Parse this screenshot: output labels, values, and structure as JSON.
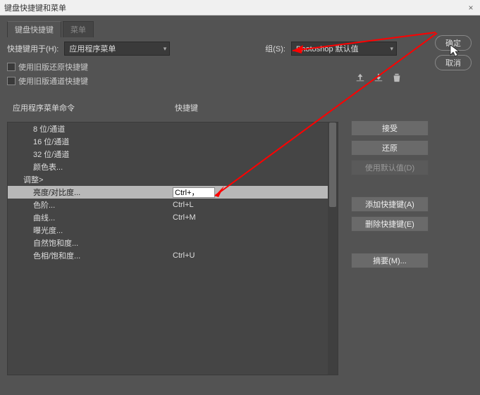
{
  "window": {
    "title": "键盘快捷键和菜单"
  },
  "tabs": {
    "active": "键盘快捷键",
    "inactive": "菜单"
  },
  "form": {
    "shortcutsForLabel": "快捷键用于(H):",
    "shortcutsForValue": "应用程序菜单",
    "setLabel": "组(S):",
    "setValue": "Photoshop 默认值",
    "legacyUndo": "使用旧版还原快捷键",
    "legacyChannel": "使用旧版通道快捷键"
  },
  "columns": {
    "command": "应用程序菜单命令",
    "shortcut": "快捷键"
  },
  "rows": [
    {
      "label": "8 位/通道",
      "shortcut": "",
      "indent": "item"
    },
    {
      "label": "16 位/通道",
      "shortcut": "",
      "indent": "item"
    },
    {
      "label": "32 位/通道",
      "shortcut": "",
      "indent": "item"
    },
    {
      "label": "颜色表...",
      "shortcut": "",
      "indent": "item"
    },
    {
      "label": "调整>",
      "shortcut": "",
      "indent": "group"
    },
    {
      "label": "亮度/对比度...",
      "shortcut": "Ctrl+，",
      "indent": "item",
      "selected": true
    },
    {
      "label": "色阶...",
      "shortcut": "Ctrl+L",
      "indent": "item"
    },
    {
      "label": "曲线...",
      "shortcut": "Ctrl+M",
      "indent": "item"
    },
    {
      "label": "曝光度...",
      "shortcut": "",
      "indent": "item"
    },
    {
      "label": "自然饱和度...",
      "shortcut": "",
      "indent": "item"
    },
    {
      "label": "色相/饱和度...",
      "shortcut": "Ctrl+U",
      "indent": "item"
    }
  ],
  "buttons": {
    "ok": "确定",
    "cancel": "取消",
    "accept": "接受",
    "undo": "还原",
    "useDefault": "使用默认值(D)",
    "addShortcut": "添加快捷键(A)",
    "deleteShortcut": "删除快捷键(E)",
    "summarize": "摘要(M)..."
  }
}
